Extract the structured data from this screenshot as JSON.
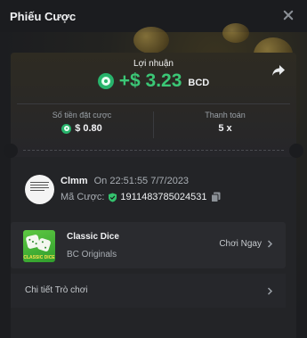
{
  "header": {
    "title": "Phiếu Cược"
  },
  "summary": {
    "profit_label": "Lợi nhuận",
    "profit_amount": "+$ 3.23",
    "profit_currency": "BCD",
    "wager_label": "Số tiền đặt cược",
    "wager_value": "$ 0.80",
    "payout_label": "Thanh toán",
    "payout_value": "5 x"
  },
  "bettor": {
    "name": "Clmm",
    "time": "On 22:51:55 7/7/2023",
    "bet_id_label": "Mã Cược:",
    "bet_id": "1911483785024531"
  },
  "game": {
    "name": "Classic Dice",
    "provider": "BC Originals",
    "thumb_text": "CLASSIC DICE",
    "play_label": "Chơi Ngay"
  },
  "details": {
    "label": "Chi tiết Trò chơi"
  },
  "colors": {
    "accent_green": "#3bc776",
    "bc_coin": "#28b46c",
    "background": "#1b1c1f"
  },
  "icons": [
    "close-icon",
    "share-icon",
    "bc-coin-icon",
    "shield-icon",
    "copy-icon",
    "chevron-right-icon"
  ]
}
